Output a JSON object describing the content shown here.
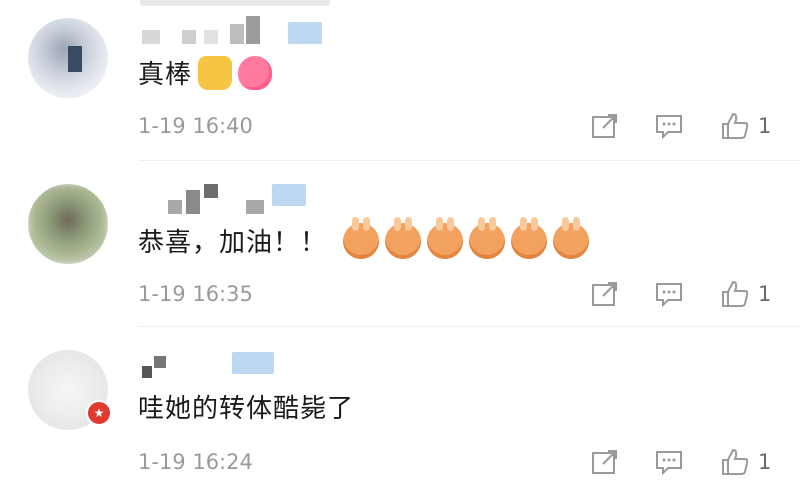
{
  "comments": [
    {
      "text": "真棒",
      "time": "1-19 16:40",
      "likes": "1",
      "emojis": [
        "thumbs-up-icon",
        "heart-icon"
      ]
    },
    {
      "text": "恭喜，加油！！",
      "time": "1-19 16:35",
      "likes": "1",
      "emojis": [
        "bunny-emoji",
        "bunny-emoji",
        "bunny-emoji",
        "bunny-emoji",
        "bunny-emoji",
        "bunny-emoji"
      ]
    },
    {
      "text": "哇她的转体酷毙了",
      "time": "1-19 16:24",
      "likes": "1",
      "emojis": []
    }
  ],
  "colors": {
    "meta_text": "#9a9a9a",
    "icon": "#9a9a9a",
    "verified": "#bcd8f3",
    "badge": "#e03a2f"
  }
}
